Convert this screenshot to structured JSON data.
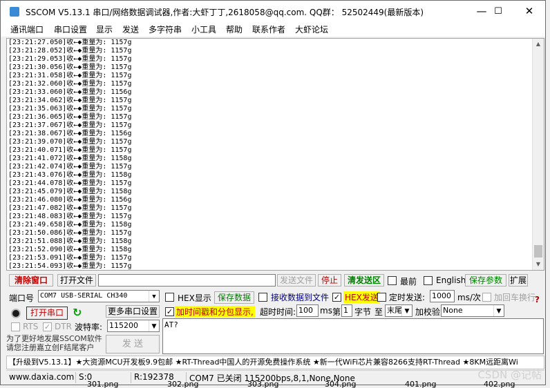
{
  "window": {
    "title": "SSCOM V5.13.1 串口/网络数据调试器,作者:大虾丁丁,2618058@qq.com. QQ群： 52502449(最新版本)",
    "controls": {
      "minimize": "—",
      "maximize": "☐",
      "close": "✕"
    }
  },
  "menu": [
    "通讯端口",
    "串口设置",
    "显示",
    "发送",
    "多字符串",
    "小工具",
    "帮助",
    "联系作者",
    "大虾论坛"
  ],
  "log": {
    "lines": [
      "[23:21:27.050]收←◆重量为: 1157g",
      "[23:21:28.052]收←◆重量为: 1157g",
      "[23:21:29.053]收←◆重量为: 1157g",
      "[23:21:30.056]收←◆重量为: 1157g",
      "[23:21:31.058]收←◆重量为: 1157g",
      "[23:21:32.060]收←◆重量为: 1157g",
      "[23:21:33.060]收←◆重量为: 1156g",
      "[23:21:34.062]收←◆重量为: 1157g",
      "[23:21:35.063]收←◆重量为: 1157g",
      "[23:21:36.065]收←◆重量为: 1157g",
      "[23:21:37.067]收←◆重量为: 1157g",
      "[23:21:38.067]收←◆重量为: 1156g",
      "[23:21:39.070]收←◆重量为: 1157g",
      "[23:21:40.071]收←◆重量为: 1157g",
      "[23:21:41.072]收←◆重量为: 1158g",
      "[23:21:42.074]收←◆重量为: 1157g",
      "[23:21:43.076]收←◆重量为: 1158g",
      "[23:21:44.078]收←◆重量为: 1157g",
      "[23:21:45.079]收←◆重量为: 1158g",
      "[23:21:46.080]收←◆重量为: 1156g",
      "[23:21:47.082]收←◆重量为: 1157g",
      "[23:21:48.083]收←◆重量为: 1157g",
      "[23:21:49.658]收←◆重量为: 1158g",
      "[23:21:50.086]收←◆重量为: 1157g",
      "[23:21:51.088]收←◆重量为: 1158g",
      "[23:21:52.090]收←◆重量为: 1158g",
      "[23:21:53.091]收←◆重量为: 1157g",
      "[23:21:54.093]收←◆重量为: 1157g"
    ]
  },
  "toolbar": {
    "clear_window": "清除窗口",
    "open_file": "打开文件",
    "send_file": "发送文件",
    "stop": "停止",
    "clear_send_area": "清发送区",
    "topmost": "最前",
    "english": "English",
    "save_params": "保存参数",
    "expand": "扩展"
  },
  "port": {
    "label": "端口号",
    "value": "COM7 USB-SERIAL CH340",
    "open_button": "打开串口",
    "more_settings": "更多串口设置",
    "rts": "RTS",
    "dtr": "DTR",
    "baud_label": "波特率:",
    "baud_value": "115200"
  },
  "options": {
    "hex_display": "HEX显示",
    "save_data": "保存数据",
    "recv_to_file": "接收数据到文件",
    "hex_send": "HEX发送",
    "timed_send": "定时发送:",
    "period_value": "1000",
    "period_unit": "ms/次",
    "add_crlf": "加回车换行",
    "timestamp": "加时间戳和分包显示,",
    "timeout_label": "超时时间:",
    "timeout_value": "100",
    "timeout_unit": "ms",
    "nth_label": "第",
    "nth_value": "1",
    "byte_label": "字节",
    "to_label": "至",
    "end_value": "末尾",
    "checksum_label": "加校验",
    "checksum_value": "None"
  },
  "send": {
    "text": "AT?",
    "button": "发 送"
  },
  "promo": "为了更好地发展SSCOM软件\n请您注册嘉立创F结尾客户",
  "ticker": "【升级到V5.13.1】★大资源MCU开发板9.9包邮 ★RT-Thread中国人的开源免费操作系统 ★新一代WiFi芯片兼容8266支持RT-Thread ★8KM远距离Wi",
  "status": {
    "site": "www.daxia.com",
    "sent": "S:0",
    "received": "R:192378",
    "port_state": "COM7 已关闭  115200bps,8,1,None,None"
  },
  "background_files": [
    "301.png",
    "302.png",
    "303.png",
    "304.png",
    "401.png",
    "402.png"
  ],
  "watermark": "CSDN @记帖",
  "colors": {
    "red_label": "#c00000",
    "green_label": "#008000",
    "highlight": "#ffff00"
  }
}
